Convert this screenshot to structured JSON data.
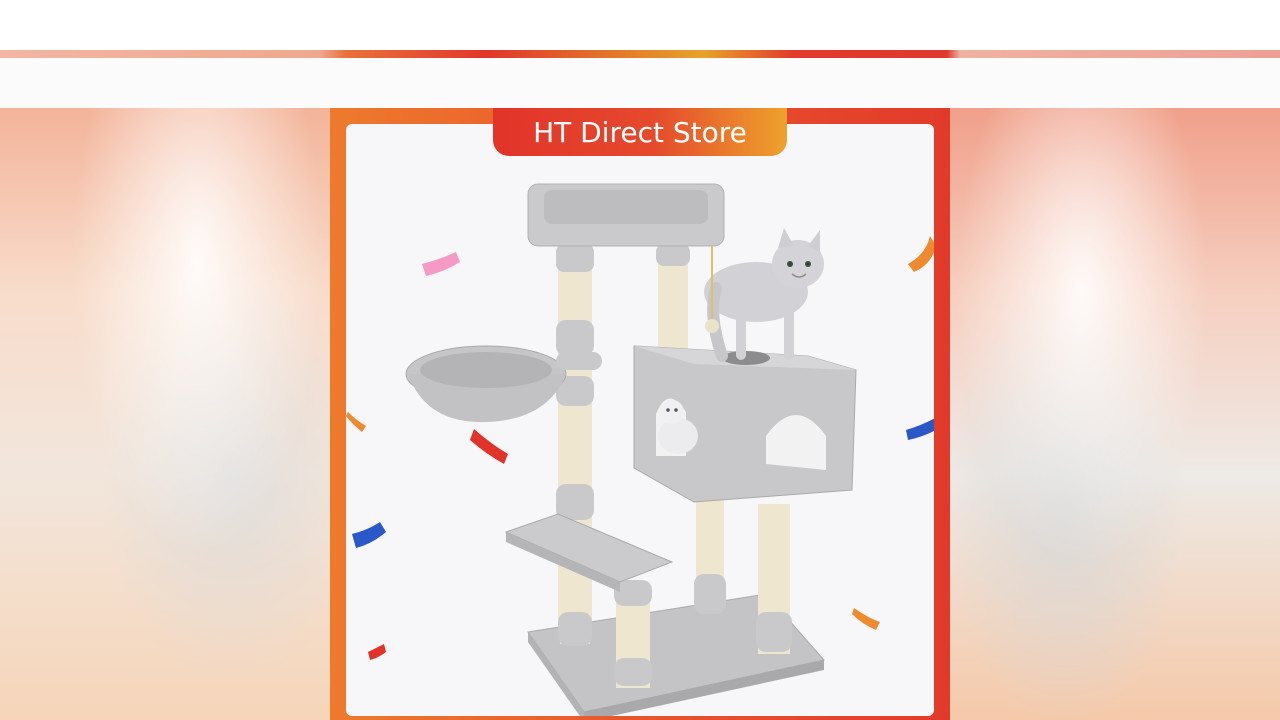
{
  "store": {
    "name": "HT Direct Store"
  },
  "colors": {
    "frame_orange": "#ee7a2c",
    "frame_red": "#e23a2a",
    "tab_red": "#e2332a",
    "tab_gold": "#eea22c",
    "plush_gray": "#c9c9cb",
    "sisal": "#efe6cf"
  },
  "image": {
    "subject": "cat-tree-with-cats-and-confetti"
  }
}
